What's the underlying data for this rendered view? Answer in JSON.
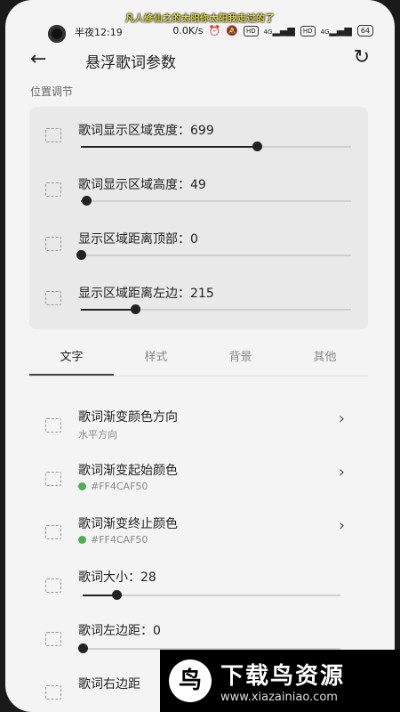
{
  "lyric_overlay": "凡人修仙之的太阳你太阳我走过的了",
  "status": {
    "time": "半夜12:19",
    "speed": "0.0K/s",
    "hd1": "HD",
    "sig1": "4G",
    "hd2": "HD",
    "sig2": "4G",
    "battery": "64"
  },
  "header": {
    "title": "悬浮歌词参数"
  },
  "position_section": {
    "label": "位置调节",
    "rows": [
      {
        "label": "歌词显示区域宽度：699",
        "value": 0.65
      },
      {
        "label": "歌词显示区域高度：49",
        "value": 0.02
      },
      {
        "label": "显示区域距离顶部：0",
        "value": 0.0
      },
      {
        "label": "显示区域距离左边：215",
        "value": 0.2
      }
    ]
  },
  "tabs": [
    "文字",
    "样式",
    "背景",
    "其他"
  ],
  "text_settings": [
    {
      "label": "歌词渐变颜色方向",
      "sub": "水平方向",
      "color": null
    },
    {
      "label": "歌词渐变起始颜色",
      "sub": "#FF4CAF50",
      "color": "#4caf50"
    },
    {
      "label": "歌词渐变终止颜色",
      "sub": "#FF4CAF50",
      "color": "#4caf50"
    }
  ],
  "sliders": [
    {
      "label": "歌词大小：28",
      "value": 0.13
    },
    {
      "label": "歌词左边距：0",
      "value": 0.0
    },
    {
      "label": "歌词右边距",
      "value": 0.0
    }
  ],
  "watermark": {
    "brand": "下载鸟资源",
    "url": "www.xiazainiao.com"
  }
}
